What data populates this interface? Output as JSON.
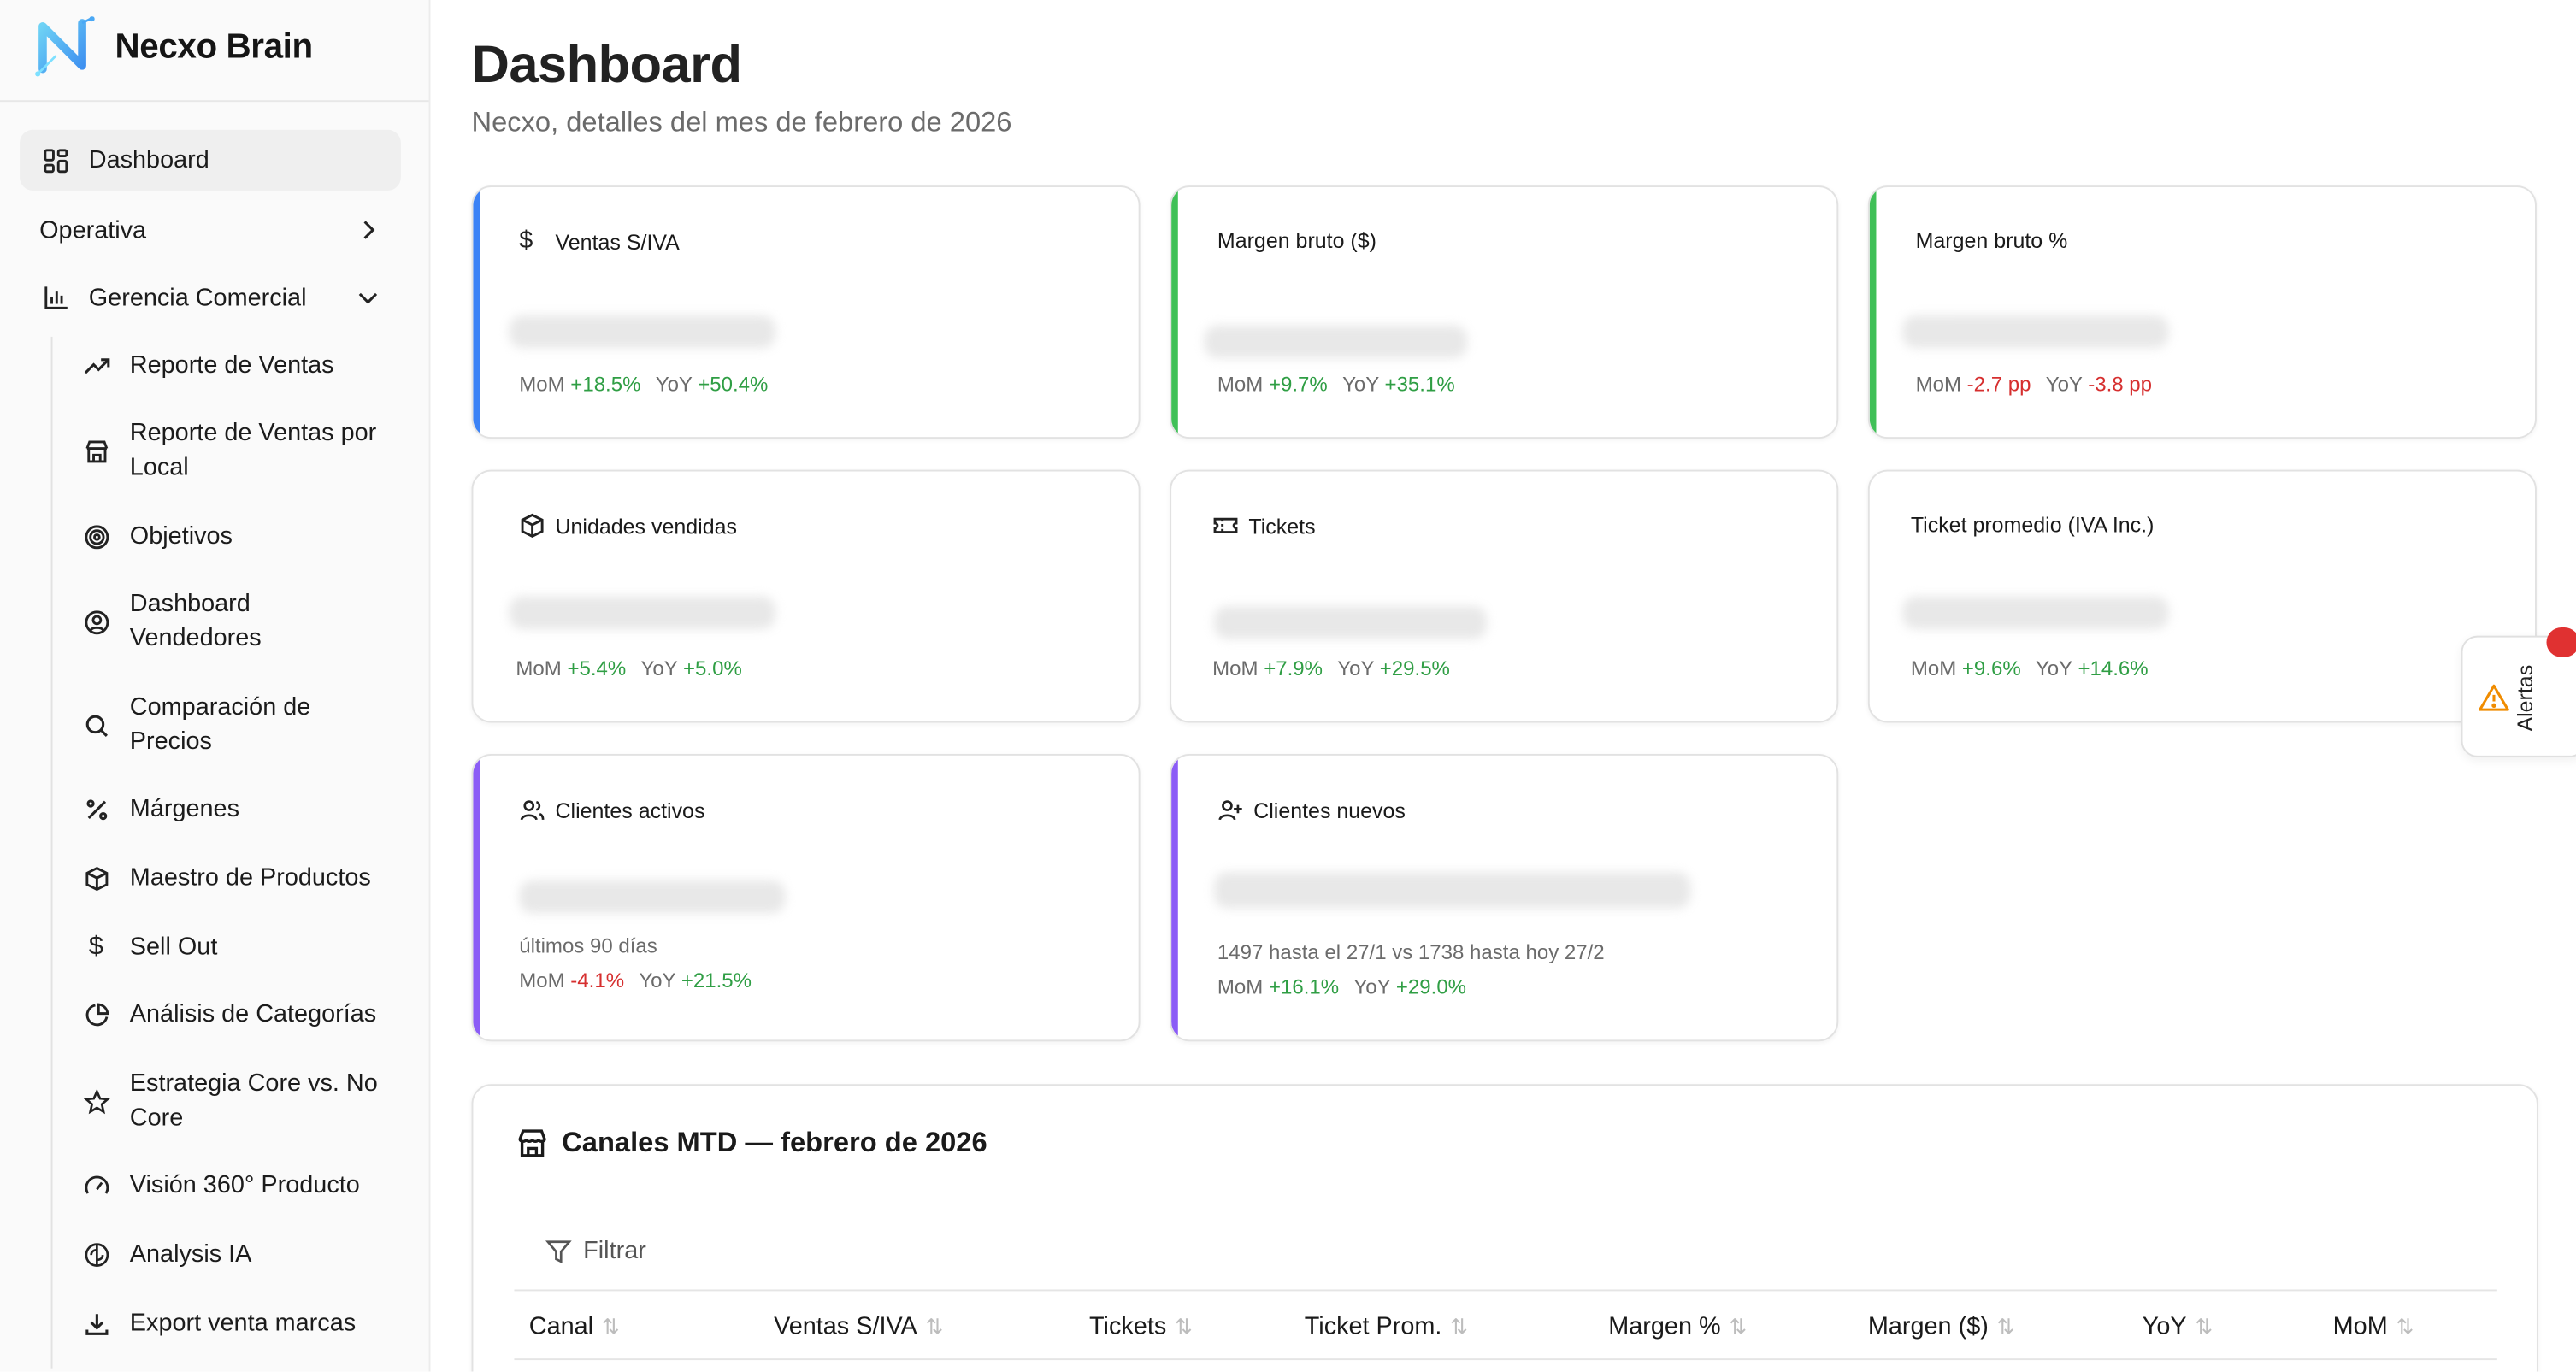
{
  "brand": {
    "name": "Necxo Brain"
  },
  "sidebar": {
    "items": [
      {
        "label": "Dashboard",
        "icon": "dashboard-grid-icon"
      },
      {
        "label": "Operativa",
        "icon": "chevron-right-icon"
      },
      {
        "label": "Gerencia Comercial",
        "icon": "bar-chart-icon"
      }
    ],
    "subitems": [
      {
        "label": "Reporte de Ventas",
        "icon": "trending-up-icon"
      },
      {
        "label": "Reporte de Ventas por Local",
        "icon": "store-icon"
      },
      {
        "label": "Objetivos",
        "icon": "target-icon"
      },
      {
        "label": "Dashboard Vendedores",
        "icon": "user-circle-icon"
      },
      {
        "label": "Comparación de Precios",
        "icon": "search-icon"
      },
      {
        "label": "Márgenes",
        "icon": "percent-icon"
      },
      {
        "label": "Maestro de Productos",
        "icon": "box-icon"
      },
      {
        "label": "Sell Out",
        "icon": "dollar-icon"
      },
      {
        "label": "Análisis de Categorías",
        "icon": "pie-chart-icon"
      },
      {
        "label": "Estrategia Core vs. No Core",
        "icon": "star-icon"
      },
      {
        "label": "Visión 360° Producto",
        "icon": "gauge-icon"
      },
      {
        "label": "Analysis IA",
        "icon": "brain-icon"
      },
      {
        "label": "Export venta marcas",
        "icon": "download-icon"
      }
    ]
  },
  "page": {
    "title": "Dashboard",
    "subtitle": "Necxo, detalles del mes de febrero de 2026"
  },
  "cards": [
    {
      "title": "Ventas S/IVA",
      "icon": "dollar-icon",
      "accent": "#3b82f6",
      "mom_label": "MoM",
      "mom": "+18.5%",
      "mom_sign": "pos",
      "yoy_label": "YoY",
      "yoy": "+50.4%",
      "yoy_sign": "pos"
    },
    {
      "title": "Margen bruto ($)",
      "icon": "",
      "accent": "#40c057",
      "mom_label": "MoM",
      "mom": "+9.7%",
      "mom_sign": "pos",
      "yoy_label": "YoY",
      "yoy": "+35.1%",
      "yoy_sign": "pos"
    },
    {
      "title": "Margen bruto %",
      "icon": "",
      "accent": "#40c057",
      "mom_label": "MoM",
      "mom": "-2.7 pp",
      "mom_sign": "neg",
      "yoy_label": "YoY",
      "yoy": "-3.8 pp",
      "yoy_sign": "neg"
    },
    {
      "title": "Unidades vendidas",
      "icon": "box-icon",
      "accent": "",
      "mom_label": "MoM",
      "mom": "+5.4%",
      "mom_sign": "pos",
      "yoy_label": "YoY",
      "yoy": "+5.0%",
      "yoy_sign": "pos"
    },
    {
      "title": "Tickets",
      "icon": "ticket-icon",
      "accent": "",
      "mom_label": "MoM",
      "mom": "+7.9%",
      "mom_sign": "pos",
      "yoy_label": "YoY",
      "yoy": "+29.5%",
      "yoy_sign": "pos"
    },
    {
      "title": "Ticket promedio (IVA Inc.)",
      "icon": "",
      "accent": "",
      "mom_label": "MoM",
      "mom": "+9.6%",
      "mom_sign": "pos",
      "yoy_label": "YoY",
      "yoy": "+14.6%",
      "yoy_sign": "pos"
    },
    {
      "title": "Clientes activos",
      "icon": "users-icon",
      "accent": "#8b5cf6",
      "note": "últimos 90 días",
      "mom_label": "MoM",
      "mom": "-4.1%",
      "mom_sign": "neg",
      "yoy_label": "YoY",
      "yoy": "+21.5%",
      "yoy_sign": "pos"
    },
    {
      "title": "Clientes nuevos",
      "icon": "user-plus-icon",
      "accent": "#8b5cf6",
      "note": "1497 hasta el 27/1 vs 1738 hasta hoy 27/2",
      "mom_label": "MoM",
      "mom": "+16.1%",
      "mom_sign": "pos",
      "yoy_label": "YoY",
      "yoy": "+29.0%",
      "yoy_sign": "pos"
    }
  ],
  "channels": {
    "title": "Canales MTD — febrero de 2026",
    "icon": "store-icon",
    "filter_label": "Filtrar",
    "columns": [
      "Canal",
      "Ventas S/IVA",
      "Tickets",
      "Ticket Prom.",
      "Margen %",
      "Margen ($)",
      "YoY",
      "MoM"
    ],
    "sort_icon": "⇅"
  },
  "alerts": {
    "label": "Alertas",
    "icon": "warning-icon"
  },
  "colors": {
    "positive": "#2f9e44",
    "negative": "#d62f2f",
    "blue_accent": "#3b82f6",
    "green_accent": "#40c057",
    "purple_accent": "#8b5cf6"
  }
}
